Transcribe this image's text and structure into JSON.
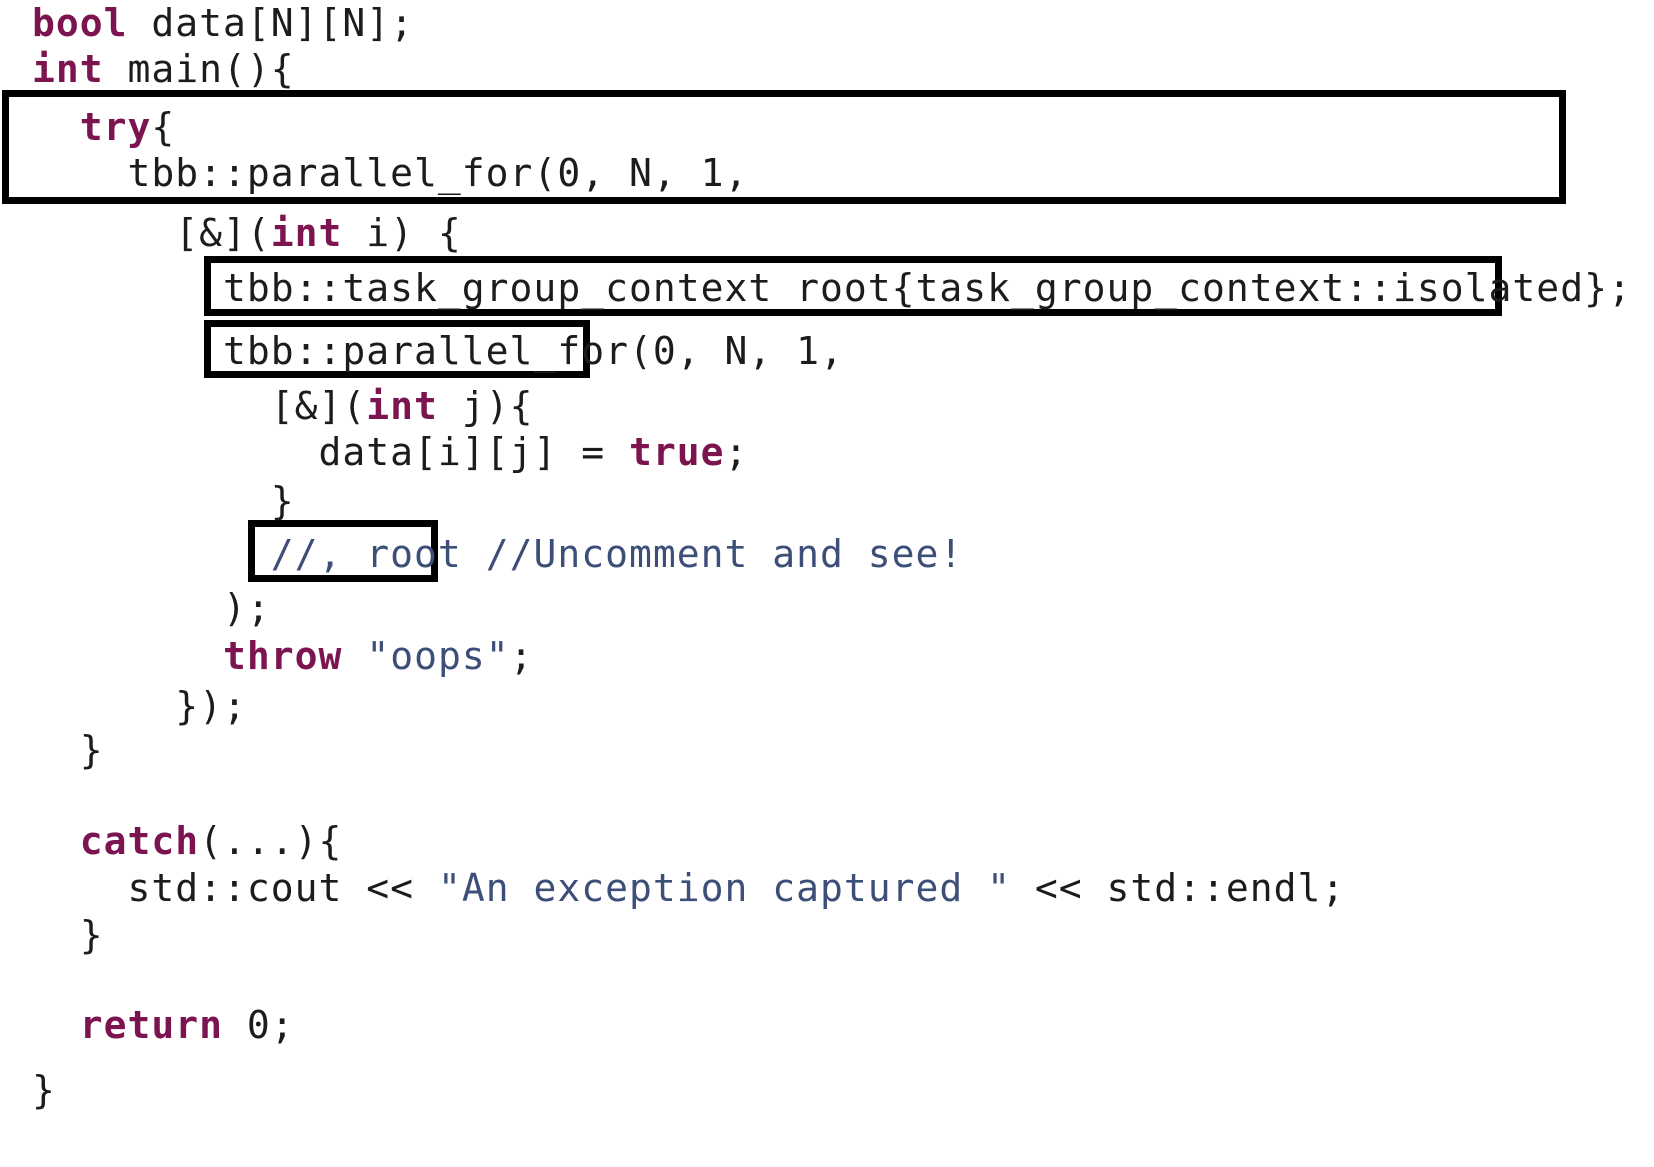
{
  "code": {
    "lines": [
      [
        {
          "t": "bool",
          "k": "kw"
        },
        {
          "t": " data[N][N];"
        }
      ],
      [
        {
          "t": "int",
          "k": "kw"
        },
        {
          "t": " main(){"
        }
      ],
      [
        {
          "t": "  "
        },
        {
          "t": "try",
          "k": "kw"
        },
        {
          "t": "{"
        }
      ],
      [
        {
          "t": "    tbb::parallel_for(0, N, 1,"
        }
      ],
      [
        {
          "t": "      [&]("
        },
        {
          "t": "int",
          "k": "kw"
        },
        {
          "t": " i) {"
        }
      ],
      [
        {
          "t": "        tbb::task_group_context root{task_group_context::isolated};"
        }
      ],
      [
        {
          "t": "        tbb::parallel_for(0, N, 1,"
        }
      ],
      [
        {
          "t": "          [&]("
        },
        {
          "t": "int",
          "k": "kw"
        },
        {
          "t": " j){"
        }
      ],
      [
        {
          "t": "            data[i][j] = "
        },
        {
          "t": "true",
          "k": "kw"
        },
        {
          "t": ";"
        }
      ],
      [
        {
          "t": "          }"
        }
      ],
      [
        {
          "t": "          "
        },
        {
          "t": "//, root",
          "k": "cmt"
        },
        {
          "t": " "
        },
        {
          "t": "//Uncomment and see!",
          "k": "cmt"
        }
      ],
      [
        {
          "t": "        );"
        }
      ],
      [
        {
          "t": "        "
        },
        {
          "t": "throw",
          "k": "kw"
        },
        {
          "t": " "
        },
        {
          "t": "\"oops\"",
          "k": "str"
        },
        {
          "t": ";"
        }
      ],
      [
        {
          "t": "      });"
        }
      ],
      [
        {
          "t": "  }"
        }
      ],
      [],
      [
        {
          "t": "  "
        },
        {
          "t": "catch",
          "k": "kw"
        },
        {
          "t": "(...){"
        }
      ],
      [
        {
          "t": "    std::cout << "
        },
        {
          "t": "\"An exception captured \"",
          "k": "str"
        },
        {
          "t": " << std::endl;"
        }
      ],
      [
        {
          "t": "  }"
        }
      ],
      [],
      [
        {
          "t": "  "
        },
        {
          "t": "return",
          "k": "kw"
        },
        {
          "t": " 0;"
        }
      ],
      [
        {
          "t": "}"
        }
      ]
    ]
  },
  "colors": {
    "keyword": "#7c1450",
    "string": "#3d4f78",
    "comment": "#3d4f78",
    "text": "#1c1c1c",
    "box_border": "#000000"
  }
}
